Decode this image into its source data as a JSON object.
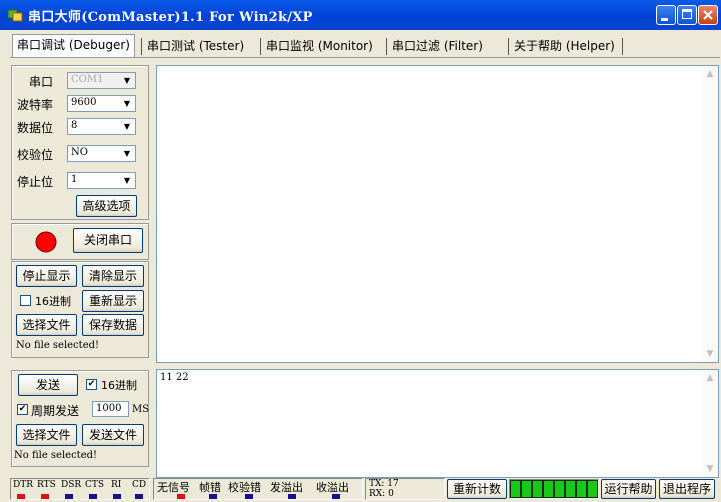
{
  "window": {
    "title": "串口大师(ComMaster)1.1 For Win2k/XP"
  },
  "tabs": [
    {
      "label": "串口调试 (Debuger)"
    },
    {
      "label": "串口测试 (Tester)"
    },
    {
      "label": "串口监视 (Monitor)"
    },
    {
      "label": "串口过滤 (Filter)"
    },
    {
      "label": "关于帮助 (Helper)"
    }
  ],
  "settings": {
    "port_label": "串口",
    "port_value": "COM1",
    "baud_label": "波特率",
    "baud_value": "9600",
    "databits_label": "数据位",
    "databits_value": "8",
    "parity_label": "校验位",
    "parity_value": "NO",
    "stopbits_label": "停止位",
    "stopbits_value": "1",
    "advanced_label": "高级选项"
  },
  "port_control": {
    "close_label": "关闭串口",
    "indicator_color": "#ff0000"
  },
  "display": {
    "stop_label": "停止显示",
    "clear_label": "清除显示",
    "hex_label": "16进制",
    "hex_checked": false,
    "redisplay_label": "重新显示",
    "choose_file_label": "选择文件",
    "save_label": "保存数据",
    "file_status": "No file selected!"
  },
  "receive": {
    "text": ""
  },
  "send": {
    "send_label": "发送",
    "hex_label": "16进制",
    "hex_checked": true,
    "period_label": "周期发送",
    "period_checked": true,
    "period_value": "1000",
    "period_unit": "MS",
    "choose_file_label": "选择文件",
    "send_file_label": "发送文件",
    "file_status": "No file selected!",
    "text": "11 22"
  },
  "statusbar": {
    "signals": [
      {
        "label": "DTR",
        "color": "#e01010"
      },
      {
        "label": "RTS",
        "color": "#e01010"
      },
      {
        "label": "DSR",
        "color": "#101090"
      },
      {
        "label": "CTS",
        "color": "#101090"
      },
      {
        "label": "RI",
        "color": "#101090"
      },
      {
        "label": "CD",
        "color": "#101090"
      }
    ],
    "errors": [
      {
        "label": "无信号",
        "color": "#e01010"
      },
      {
        "label": "帧错",
        "color": "#101090"
      },
      {
        "label": "校验错",
        "color": "#101090"
      },
      {
        "label": "发溢出",
        "color": "#101090"
      },
      {
        "label": "收溢出",
        "color": "#101090"
      }
    ],
    "tx": "TX: 17",
    "rx": "RX: 0",
    "reset_count_label": "重新计数",
    "run_help_label": "运行帮助",
    "exit_label": "退出程序"
  }
}
